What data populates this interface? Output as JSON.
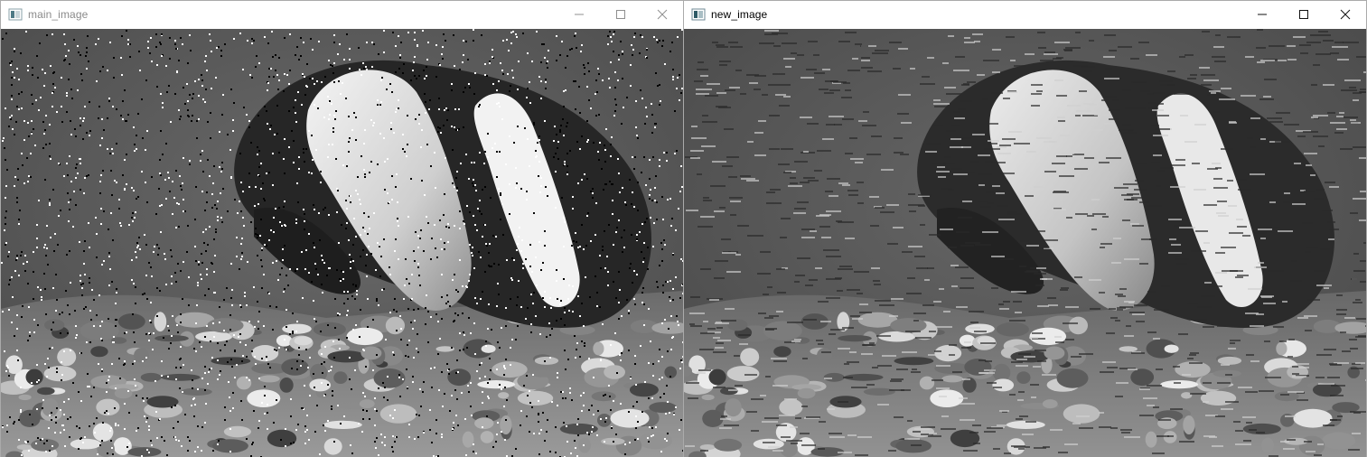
{
  "windows": [
    {
      "id": "main",
      "title": "main_image",
      "active": false,
      "content": "grayscale penguin photo with salt-and-pepper noise"
    },
    {
      "id": "new",
      "title": "new_image",
      "active": true,
      "content": "grayscale penguin photo after filtering, horizontal streak artifacts"
    }
  ],
  "controls": {
    "minimize": "minimize-icon",
    "maximize": "maximize-icon",
    "close": "close-icon"
  },
  "colors": {
    "titlebar_bg": "#ffffff",
    "inactive_title": "#8a8a8a",
    "active_title": "#000000",
    "border": "#aaaaaa"
  }
}
